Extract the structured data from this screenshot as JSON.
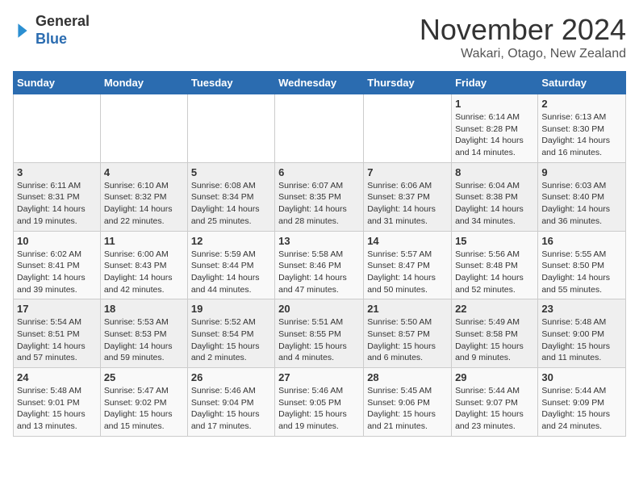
{
  "header": {
    "logo_line1": "General",
    "logo_line2": "Blue",
    "month": "November 2024",
    "location": "Wakari, Otago, New Zealand"
  },
  "columns": [
    "Sunday",
    "Monday",
    "Tuesday",
    "Wednesday",
    "Thursday",
    "Friday",
    "Saturday"
  ],
  "rows": [
    [
      {
        "empty": true
      },
      {
        "empty": true
      },
      {
        "empty": true
      },
      {
        "empty": true
      },
      {
        "empty": true
      },
      {
        "day": "1",
        "sunrise": "6:14 AM",
        "sunset": "8:28 PM",
        "daylight": "14 hours and 14 minutes."
      },
      {
        "day": "2",
        "sunrise": "6:13 AM",
        "sunset": "8:30 PM",
        "daylight": "14 hours and 16 minutes."
      }
    ],
    [
      {
        "day": "3",
        "sunrise": "6:11 AM",
        "sunset": "8:31 PM",
        "daylight": "14 hours and 19 minutes."
      },
      {
        "day": "4",
        "sunrise": "6:10 AM",
        "sunset": "8:32 PM",
        "daylight": "14 hours and 22 minutes."
      },
      {
        "day": "5",
        "sunrise": "6:08 AM",
        "sunset": "8:34 PM",
        "daylight": "14 hours and 25 minutes."
      },
      {
        "day": "6",
        "sunrise": "6:07 AM",
        "sunset": "8:35 PM",
        "daylight": "14 hours and 28 minutes."
      },
      {
        "day": "7",
        "sunrise": "6:06 AM",
        "sunset": "8:37 PM",
        "daylight": "14 hours and 31 minutes."
      },
      {
        "day": "8",
        "sunrise": "6:04 AM",
        "sunset": "8:38 PM",
        "daylight": "14 hours and 34 minutes."
      },
      {
        "day": "9",
        "sunrise": "6:03 AM",
        "sunset": "8:40 PM",
        "daylight": "14 hours and 36 minutes."
      }
    ],
    [
      {
        "day": "10",
        "sunrise": "6:02 AM",
        "sunset": "8:41 PM",
        "daylight": "14 hours and 39 minutes."
      },
      {
        "day": "11",
        "sunrise": "6:00 AM",
        "sunset": "8:43 PM",
        "daylight": "14 hours and 42 minutes."
      },
      {
        "day": "12",
        "sunrise": "5:59 AM",
        "sunset": "8:44 PM",
        "daylight": "14 hours and 44 minutes."
      },
      {
        "day": "13",
        "sunrise": "5:58 AM",
        "sunset": "8:46 PM",
        "daylight": "14 hours and 47 minutes."
      },
      {
        "day": "14",
        "sunrise": "5:57 AM",
        "sunset": "8:47 PM",
        "daylight": "14 hours and 50 minutes."
      },
      {
        "day": "15",
        "sunrise": "5:56 AM",
        "sunset": "8:48 PM",
        "daylight": "14 hours and 52 minutes."
      },
      {
        "day": "16",
        "sunrise": "5:55 AM",
        "sunset": "8:50 PM",
        "daylight": "14 hours and 55 minutes."
      }
    ],
    [
      {
        "day": "17",
        "sunrise": "5:54 AM",
        "sunset": "8:51 PM",
        "daylight": "14 hours and 57 minutes."
      },
      {
        "day": "18",
        "sunrise": "5:53 AM",
        "sunset": "8:53 PM",
        "daylight": "14 hours and 59 minutes."
      },
      {
        "day": "19",
        "sunrise": "5:52 AM",
        "sunset": "8:54 PM",
        "daylight": "15 hours and 2 minutes."
      },
      {
        "day": "20",
        "sunrise": "5:51 AM",
        "sunset": "8:55 PM",
        "daylight": "15 hours and 4 minutes."
      },
      {
        "day": "21",
        "sunrise": "5:50 AM",
        "sunset": "8:57 PM",
        "daylight": "15 hours and 6 minutes."
      },
      {
        "day": "22",
        "sunrise": "5:49 AM",
        "sunset": "8:58 PM",
        "daylight": "15 hours and 9 minutes."
      },
      {
        "day": "23",
        "sunrise": "5:48 AM",
        "sunset": "9:00 PM",
        "daylight": "15 hours and 11 minutes."
      }
    ],
    [
      {
        "day": "24",
        "sunrise": "5:48 AM",
        "sunset": "9:01 PM",
        "daylight": "15 hours and 13 minutes."
      },
      {
        "day": "25",
        "sunrise": "5:47 AM",
        "sunset": "9:02 PM",
        "daylight": "15 hours and 15 minutes."
      },
      {
        "day": "26",
        "sunrise": "5:46 AM",
        "sunset": "9:04 PM",
        "daylight": "15 hours and 17 minutes."
      },
      {
        "day": "27",
        "sunrise": "5:46 AM",
        "sunset": "9:05 PM",
        "daylight": "15 hours and 19 minutes."
      },
      {
        "day": "28",
        "sunrise": "5:45 AM",
        "sunset": "9:06 PM",
        "daylight": "15 hours and 21 minutes."
      },
      {
        "day": "29",
        "sunrise": "5:44 AM",
        "sunset": "9:07 PM",
        "daylight": "15 hours and 23 minutes."
      },
      {
        "day": "30",
        "sunrise": "5:44 AM",
        "sunset": "9:09 PM",
        "daylight": "15 hours and 24 minutes."
      }
    ]
  ]
}
